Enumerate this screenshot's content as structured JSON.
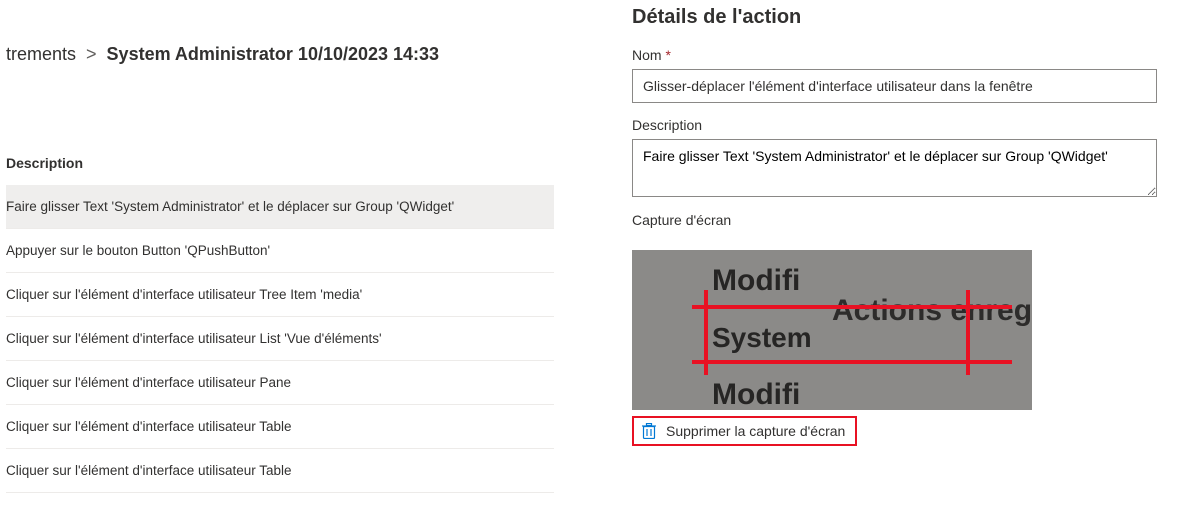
{
  "breadcrumb": {
    "prev_fragment": "trements",
    "chevron": ">",
    "current": "System Administrator 10/10/2023 14:33"
  },
  "list": {
    "column_header": "Description",
    "rows": [
      {
        "desc": "Faire glisser Text 'System Administrator' et le déplacer sur Group 'QWidget'",
        "selected": true
      },
      {
        "desc": "Appuyer sur le bouton Button 'QPushButton'",
        "selected": false
      },
      {
        "desc": "Cliquer sur l'élément d'interface utilisateur Tree Item 'media'",
        "selected": false
      },
      {
        "desc": "Cliquer sur l'élément d'interface utilisateur List 'Vue d'éléments'",
        "selected": false
      },
      {
        "desc": "Cliquer sur l'élément d'interface utilisateur Pane",
        "selected": false
      },
      {
        "desc": "Cliquer sur l'élément d'interface utilisateur Table",
        "selected": false
      },
      {
        "desc": "Cliquer sur l'élément d'interface utilisateur Table",
        "selected": false
      }
    ]
  },
  "details": {
    "panel_title": "Détails de l'action",
    "name_label": "Nom",
    "required_mark": "*",
    "name_value": "Glisser-déplacer l'élément d'interface utilisateur dans la fenêtre",
    "desc_label": "Description",
    "desc_value": "Faire glisser Text 'System Administrator' et le déplacer sur Group 'QWidget'",
    "screenshot_label": "Capture d'écran",
    "thumb": {
      "t1": "Modifi",
      "t2": "Actions enregi",
      "t3": "System",
      "t4": "Modifi"
    },
    "delete_label": "Supprimer la capture d'écran"
  },
  "colors": {
    "accent_red": "#e81123",
    "border_gray": "#8a8886",
    "row_divider": "#edebe9"
  }
}
